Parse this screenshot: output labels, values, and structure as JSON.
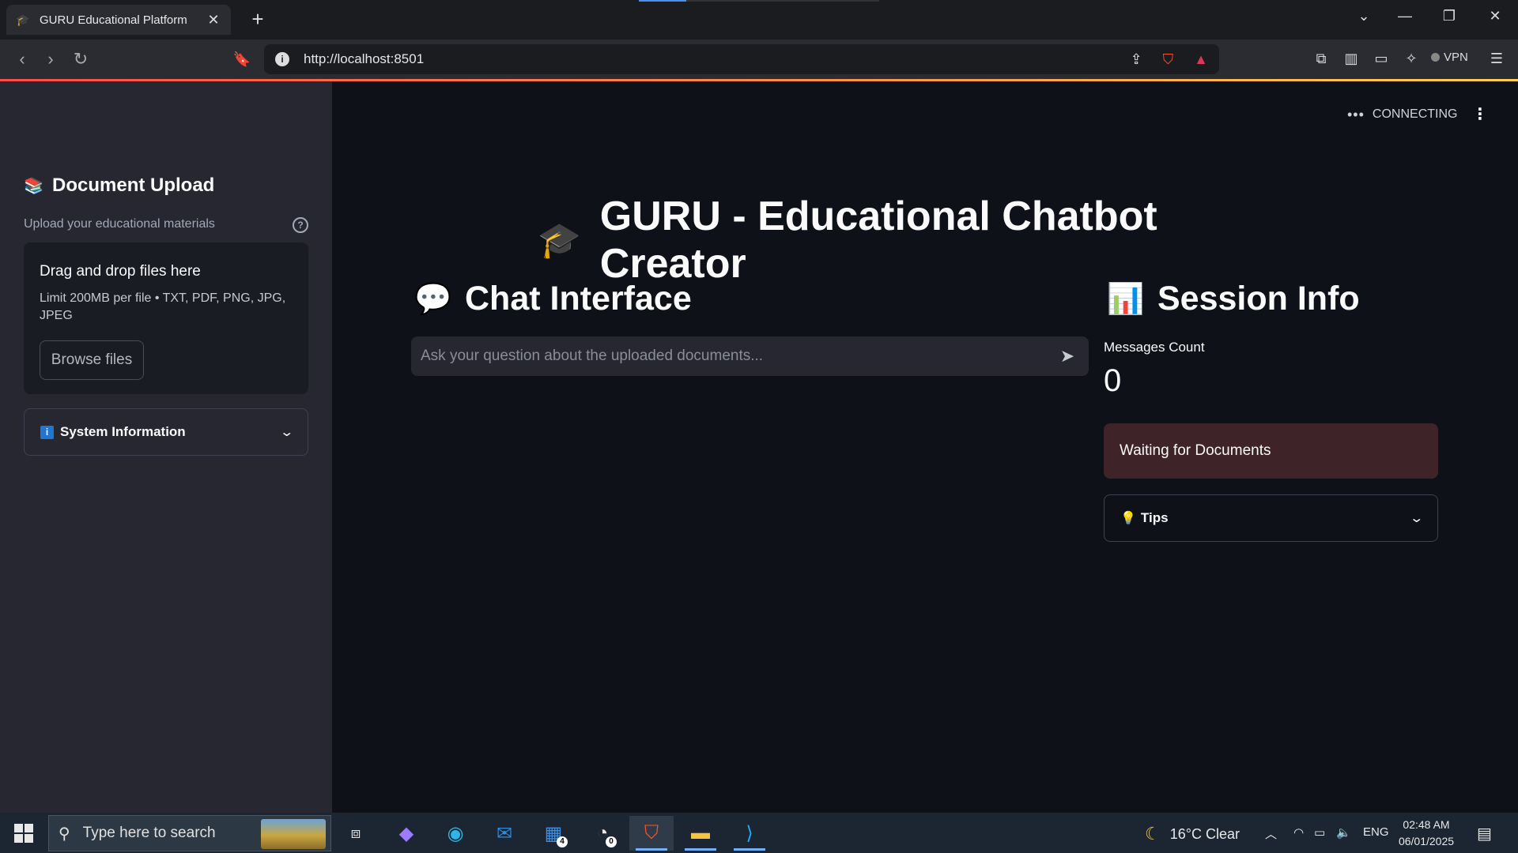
{
  "browser": {
    "tab_title": "GURU Educational Platform",
    "tab_icon": "graduation-cap-icon",
    "url": "http://localhost:8501",
    "vpn_label": "VPN"
  },
  "sidebar": {
    "heading": "Document Upload",
    "heading_icon": "books-icon",
    "upload_label": "Upload your educational materials",
    "dropzone_title": "Drag and drop files here",
    "dropzone_limit": "Limit 200MB per file • TXT, PDF, PNG, JPG, JPEG",
    "browse_label": "Browse files",
    "system_info_label": "System Information"
  },
  "status": {
    "connection": "CONNECTING"
  },
  "main": {
    "title": "GURU - Educational Chatbot Creator",
    "chat_heading": "Chat Interface",
    "chat_placeholder": "Ask your question about the uploaded documents...",
    "session_heading": "Session Info",
    "messages_label": "Messages Count",
    "messages_value": "0",
    "status_text": "Waiting for Documents",
    "tips_label": "Tips"
  },
  "taskbar": {
    "search_placeholder": "Type here to search",
    "weather": "16°C  Clear",
    "language": "ENG",
    "time": "02:48 AM",
    "date": "06/01/2025",
    "outlook_badge": "4",
    "clock_app_badge": "0"
  },
  "colors": {
    "app_background": "#0e1117",
    "sidebar_background": "#262730",
    "status_warning_bg": "#3e2329",
    "accent_line_start": "#ff4b4b"
  }
}
